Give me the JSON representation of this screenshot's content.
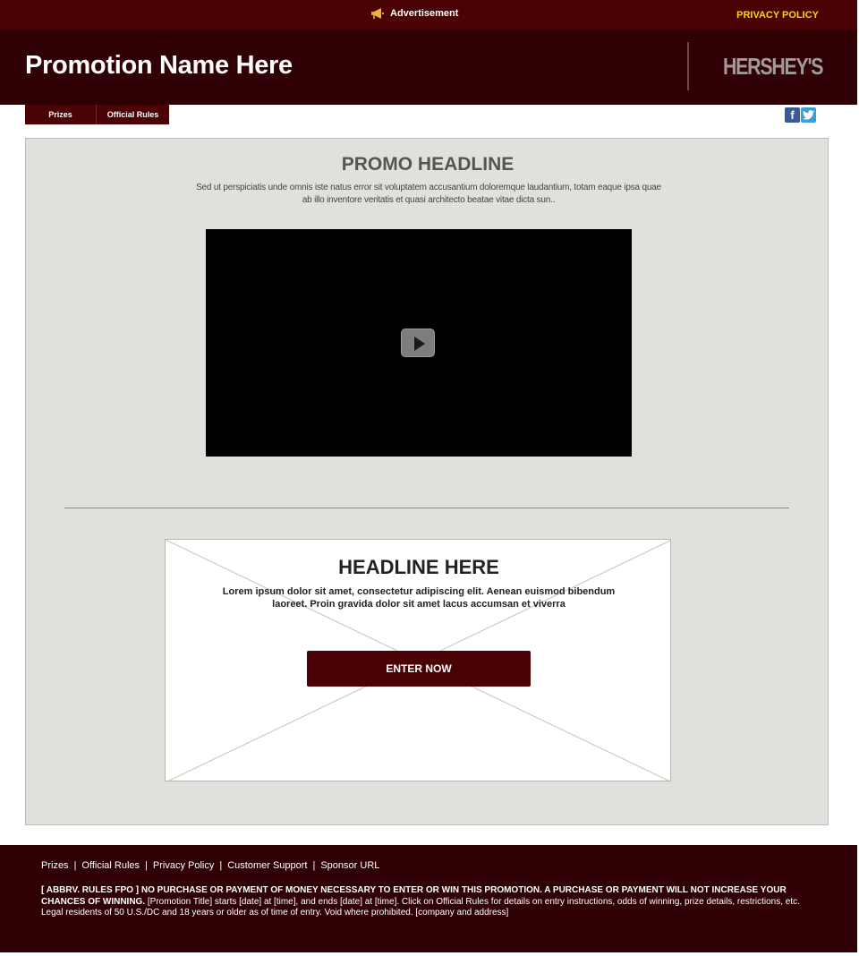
{
  "ad_bar": {
    "label": "Advertisement",
    "icon": "megaphone-icon",
    "privacy_link": "PRIVACY POLICY"
  },
  "header": {
    "promotion_name": "Promotion Name Here",
    "logo_text": "HERSHEY'S"
  },
  "subnav": {
    "items": [
      {
        "label": "Prizes"
      },
      {
        "label": "Official Rules"
      }
    ]
  },
  "social": {
    "facebook_icon": "facebook-icon",
    "facebook_glyph": "f",
    "twitter_icon": "twitter-icon"
  },
  "promo": {
    "headline": "PROMO HEADLINE",
    "copy": "Sed ut perspiciatis unde omnis iste natus error sit voluptatem accusantium doloremque laudantium, totam eaque ipsa quae ab illo inventore veritatis et quasi architecto beatae vitae dicta sun..",
    "video_icon": "play-icon"
  },
  "entry": {
    "headline": "HEADLINE HERE",
    "copy": "Lorem ipsum dolor sit amet, consectetur adipiscing elit. Aenean euismod bibendum laoreet. Proin gravida dolor sit amet lacus accumsan et viverra",
    "button_label": "ENTER NOW"
  },
  "footer": {
    "links": [
      "Prizes",
      "Official Rules",
      "Privacy Policy",
      "Customer Support",
      "Sponsor URL"
    ],
    "separator": "|",
    "legal_bold": "[ ABBRV. RULES FPO ] NO PURCHASE OR PAYMENT OF MONEY NECESSARY TO ENTER OR WIN THIS PROMOTION. A PURCHASE OR PAYMENT WILL NOT INCREASE YOUR CHANCES OF WINNING.",
    "legal_text": " [Promotion Title] starts [date] at [time], and ends  [date] at [time]. Click on Official Rules for details on entry instructions, odds of winning, prize details, restrictions, etc. Legal residents of 50 U.S./DC and 18 years or older as of time of entry. Void where prohibited. [company and address]"
  },
  "colors": {
    "ad_bar": "#4a0204",
    "header": "#300104",
    "privacy_link": "#f5d800",
    "panel": "#e2e0dc",
    "button": "#4a0204"
  }
}
